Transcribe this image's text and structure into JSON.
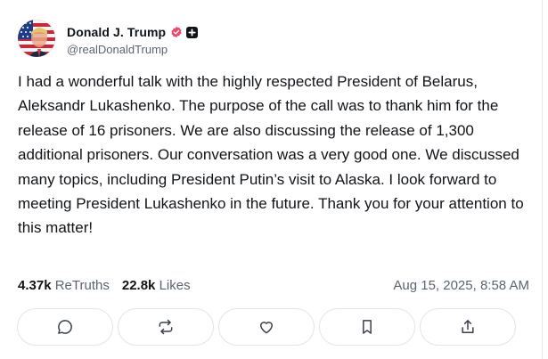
{
  "author": {
    "display_name": "Donald J. Trump",
    "handle": "@realDonaldTrump",
    "avatar_icon": "flag-portrait-avatar",
    "verified_icon": "verified-badge-icon",
    "verified_color": "#ef476f",
    "extra_badge_icon": "plus-badge-icon"
  },
  "post": {
    "text": "I had a wonderful talk with the highly respected President of Belarus, Aleksandr Lukashenko. The purpose of the call was to thank him for the release of 16 prisoners. We are also discussing the release of 1,300 additional prisoners. Our conversation was a very good one. We discussed many topics, including President Putin’s visit to Alaska. I look forward to meeting President Lukashenko in the future. Thank you for your attention to this matter!"
  },
  "stats": {
    "retruths_count": "4.37k",
    "retruths_label": "ReTruths",
    "likes_count": "22.8k",
    "likes_label": "Likes"
  },
  "timestamp": "Aug 15, 2025, 8:58 AM",
  "actions": [
    {
      "name": "reply",
      "icon": "comment-icon"
    },
    {
      "name": "retruth",
      "icon": "repost-icon"
    },
    {
      "name": "like",
      "icon": "heart-icon"
    },
    {
      "name": "bookmark",
      "icon": "bookmark-icon"
    },
    {
      "name": "share",
      "icon": "share-icon"
    }
  ],
  "colors": {
    "text": "#111418",
    "muted": "#5b6470",
    "border": "#e3e5e8"
  }
}
